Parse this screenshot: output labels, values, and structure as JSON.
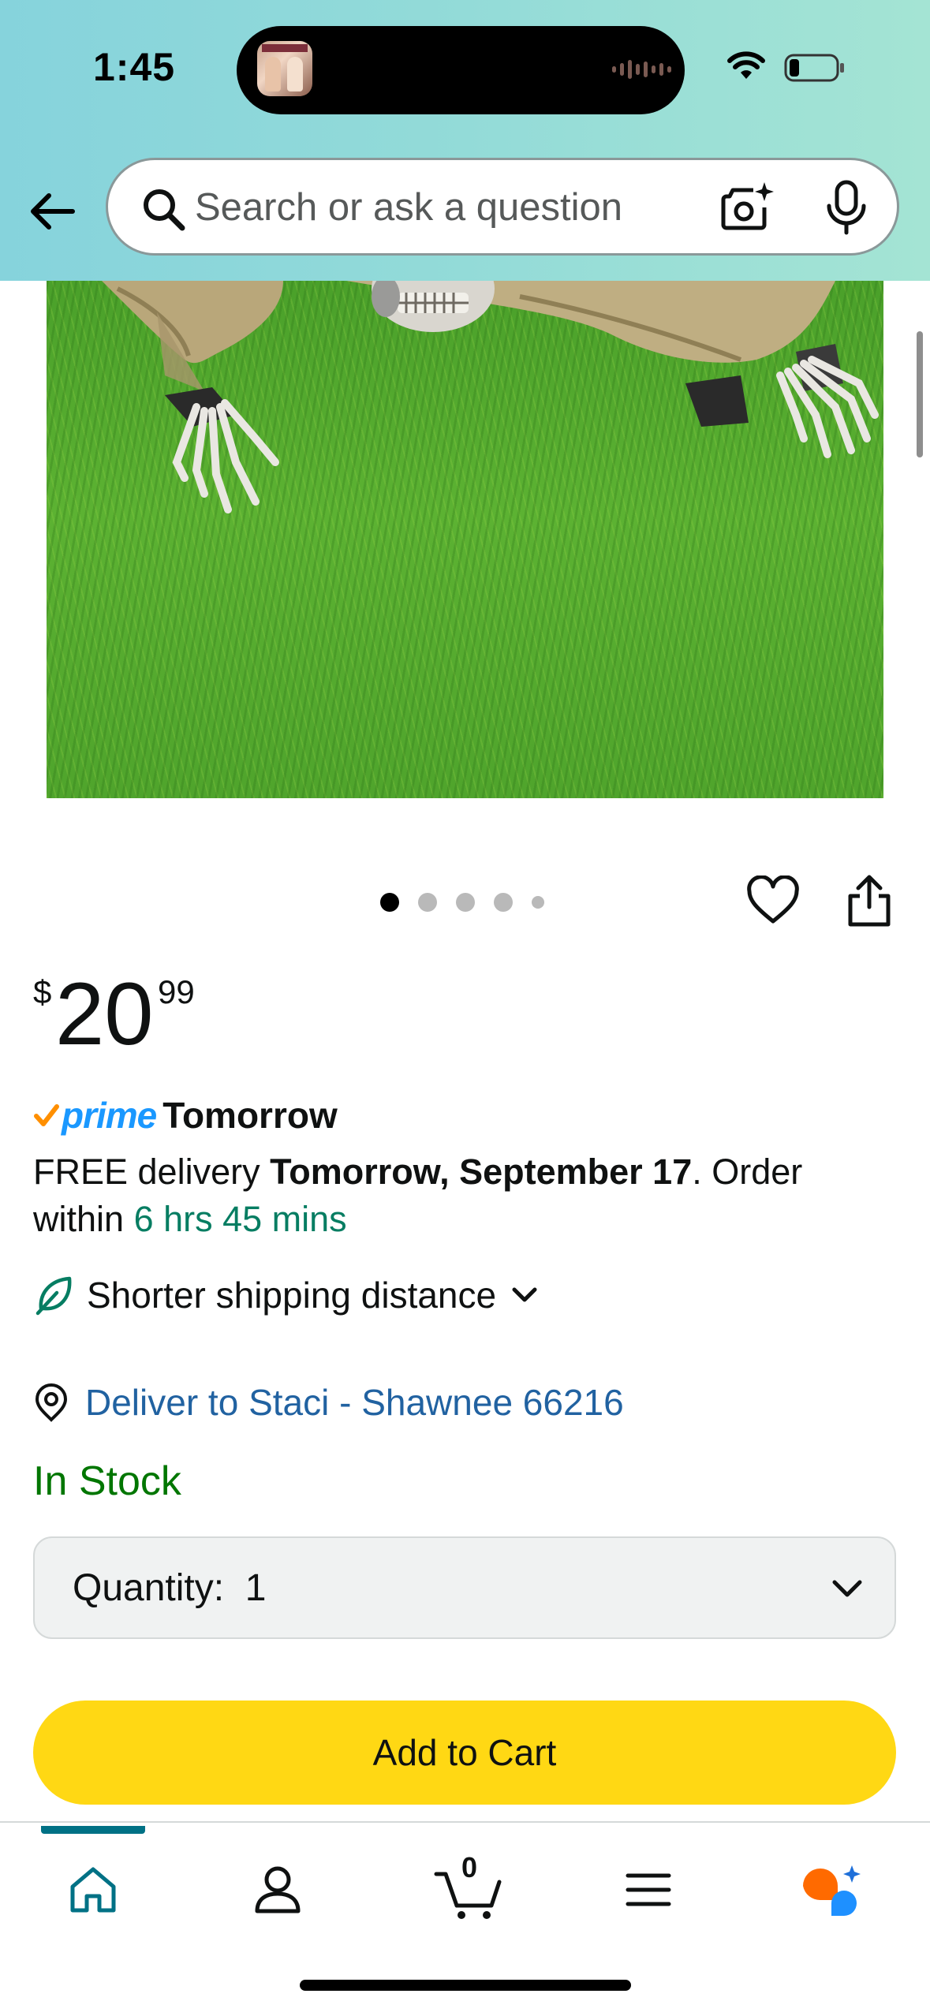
{
  "status_bar": {
    "time": "1:45"
  },
  "search": {
    "placeholder": "Search or ask a question"
  },
  "product": {
    "image_alt": "Skeleton groundbreaker decoration on grass",
    "gallery": {
      "count": 5,
      "active_index": 0
    }
  },
  "price": {
    "symbol": "$",
    "whole": "20",
    "fraction": "99"
  },
  "delivery": {
    "prime_label": "prime",
    "prime_day": "Tomorrow",
    "free_text": "FREE delivery ",
    "date_bold": "Tomorrow, September 17",
    "order_text": ". Order within ",
    "countdown": "6 hrs 45 mins",
    "shipping_note": "Shorter shipping distance",
    "deliver_to": "Deliver to Staci - Shawnee 66216"
  },
  "stock": {
    "status": "In Stock"
  },
  "quantity": {
    "label": "Quantity:",
    "value": "1"
  },
  "actions": {
    "add_to_cart": "Add to Cart"
  },
  "nav": {
    "cart_count": "0"
  },
  "colors": {
    "header_gradient_start": "#86d3dc",
    "header_gradient_end": "#a4e4d4",
    "link": "#2162a1",
    "in_stock": "#007600",
    "countdown": "#067d62",
    "add_to_cart": "#ffd814",
    "prime_blue": "#1a98ff",
    "nav_active": "#007185"
  },
  "icons": [
    "back-arrow-icon",
    "search-icon",
    "camera-icon",
    "microphone-icon",
    "heart-icon",
    "share-icon",
    "leaf-icon",
    "location-pin-icon",
    "chevron-down-icon",
    "home-icon",
    "account-icon",
    "cart-icon",
    "menu-icon",
    "rufus-icon"
  ]
}
